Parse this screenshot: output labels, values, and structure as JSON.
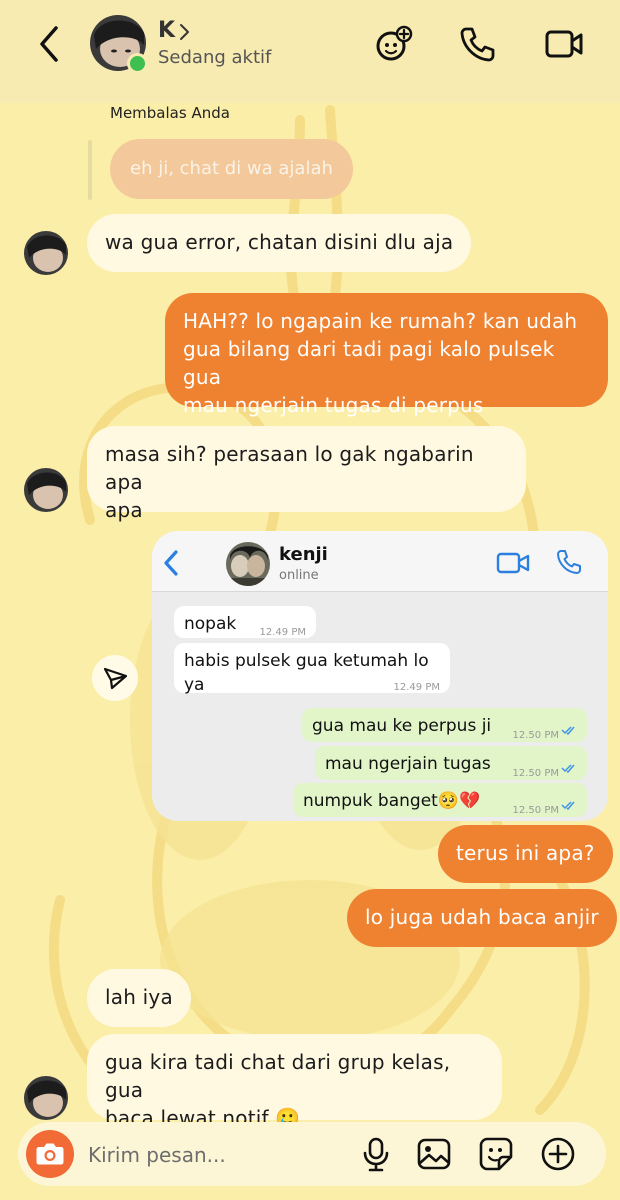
{
  "header": {
    "contact_name": "K",
    "status": "Sedang aktif",
    "icons": [
      "back-arrow-icon",
      "chevron-right-icon",
      "effects-icon",
      "phone-icon",
      "video-icon"
    ]
  },
  "reply": {
    "label": "Membalas Anda",
    "quoted_text": "eh ji, chat di wa ajalah"
  },
  "messages": [
    {
      "side": "in",
      "text": "wa gua error, chatan disini dlu aja"
    },
    {
      "side": "out",
      "lines": [
        "HAH?? lo ngapain ke rumah? kan udah",
        "gua bilang dari tadi pagi kalo pulsek gua",
        "mau ngerjain tugas di perpus"
      ]
    },
    {
      "side": "in",
      "lines": [
        "masa sih? perasaan lo gak ngabarin apa",
        "apa"
      ]
    },
    {
      "side": "out",
      "text": "terus ini apa?"
    },
    {
      "side": "out",
      "text": "lo juga udah baca anjir"
    },
    {
      "side": "in",
      "text": "lah iya"
    },
    {
      "side": "in",
      "lines": [
        "gua kira tadi chat dari grup kelas, gua",
        "baca lewat notif 🥲"
      ]
    }
  ],
  "screenshot": {
    "contact_name": "kenji",
    "status": "online",
    "messages": [
      {
        "side": "in",
        "text": "nopak",
        "time": "12.49 PM"
      },
      {
        "side": "in",
        "text": "habis pulsek gua ketumah lo ya",
        "time": "12.49 PM"
      },
      {
        "side": "out",
        "text": "gua mau ke perpus ji",
        "time": "12.50 PM"
      },
      {
        "side": "out",
        "text": "mau ngerjain tugas",
        "time": "12.50 PM"
      },
      {
        "side": "out",
        "text": "numpuk banget🥺💔",
        "time": "12.50 PM"
      }
    ]
  },
  "composer": {
    "placeholder": "Kirim pesan...",
    "icons": [
      "camera-icon",
      "microphone-icon",
      "gallery-icon",
      "sticker-icon",
      "add-icon"
    ]
  },
  "colors": {
    "background": "#fbeea8",
    "outgoing_bubble": "#ef8231",
    "incoming_bubble": "#fff9e2",
    "online": "#3fbf4f",
    "camera_button": "#f26a36",
    "whatsapp_blue": "#2b7fe0"
  }
}
